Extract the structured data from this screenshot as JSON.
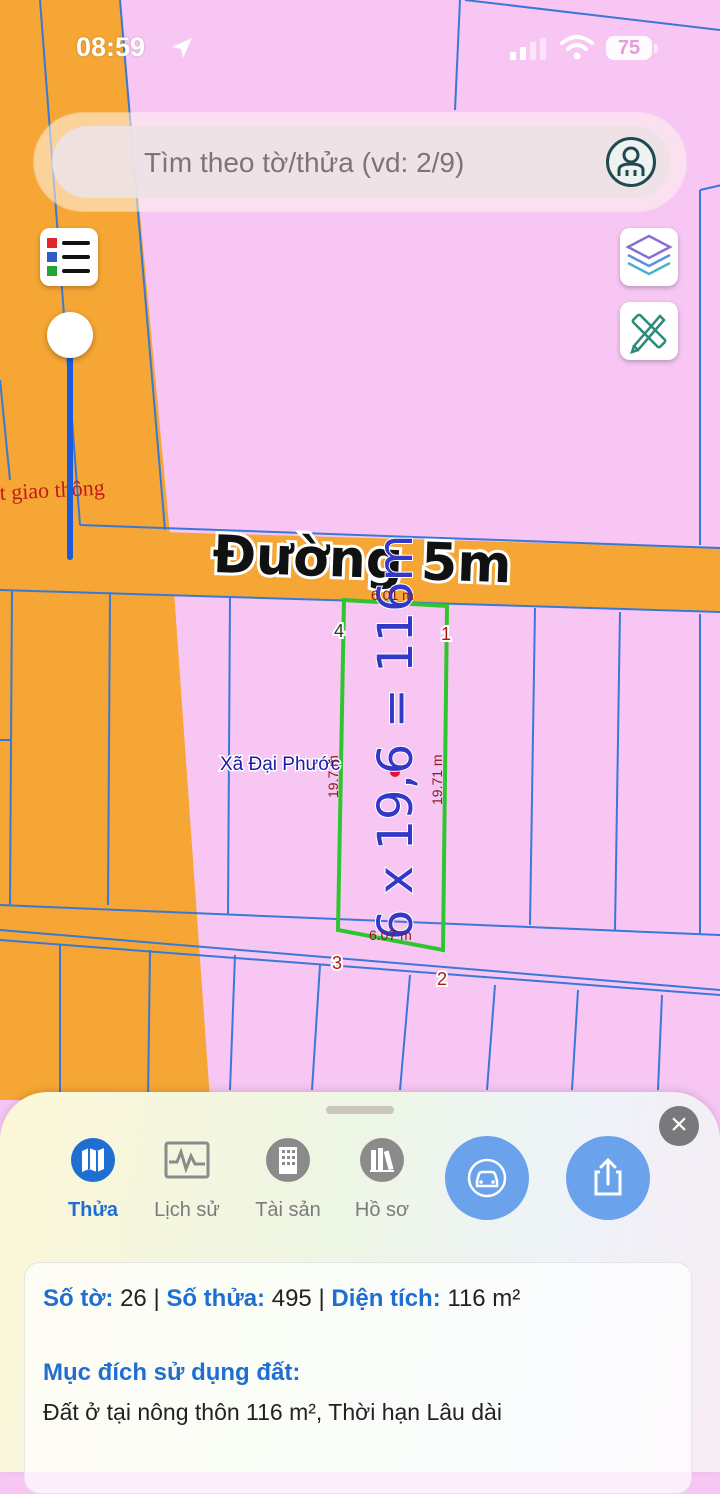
{
  "status_bar": {
    "time": "08:59",
    "battery": "75",
    "icons": [
      "location-arrow-icon",
      "cellular-signal-icon",
      "wifi-icon",
      "battery-icon"
    ]
  },
  "search": {
    "placeholder": "Tìm theo tờ/thửa (vd: 2/9)"
  },
  "map": {
    "road_label": "Đường 5m",
    "side_label": "t giao thông",
    "commune_label": "Xã Đại Phước",
    "parcel_annotation": "6 x 19,6 = 116m",
    "edge_top": "6.01 m",
    "edge_left": "19.7 m",
    "edge_right": "19.71 m",
    "edge_bottom": "6.07 m",
    "vertex_1": "1",
    "vertex_2": "2",
    "vertex_3": "3",
    "vertex_4": "4",
    "colors": {
      "residential": "#f7c6f3",
      "road": "#f5a634",
      "boundary": "#3a78d8",
      "selected": "#2ec52e",
      "annotation": "#3338c9",
      "label_red": "#c41a1a"
    }
  },
  "sheet": {
    "tabs": [
      {
        "label": "Thửa",
        "icon": "map-icon",
        "active": true
      },
      {
        "label": "Lịch sử",
        "icon": "history-icon",
        "active": false
      },
      {
        "label": "Tài sản",
        "icon": "building-icon",
        "active": false
      },
      {
        "label": "Hồ sơ",
        "icon": "books-icon",
        "active": false
      }
    ],
    "actions": [
      "car-icon",
      "share-icon"
    ],
    "info": {
      "so_to_label": "Số tờ:",
      "so_to": "26",
      "so_thua_label": "Số thửa:",
      "so_thua": "495",
      "dien_tich_label": "Diện tích:",
      "dien_tich": "116 m²",
      "purpose_label": "Mục đích sử dụng đất:",
      "purpose_value": "Đất ở tại nông thôn 116 m², Thời hạn Lâu dài"
    }
  }
}
